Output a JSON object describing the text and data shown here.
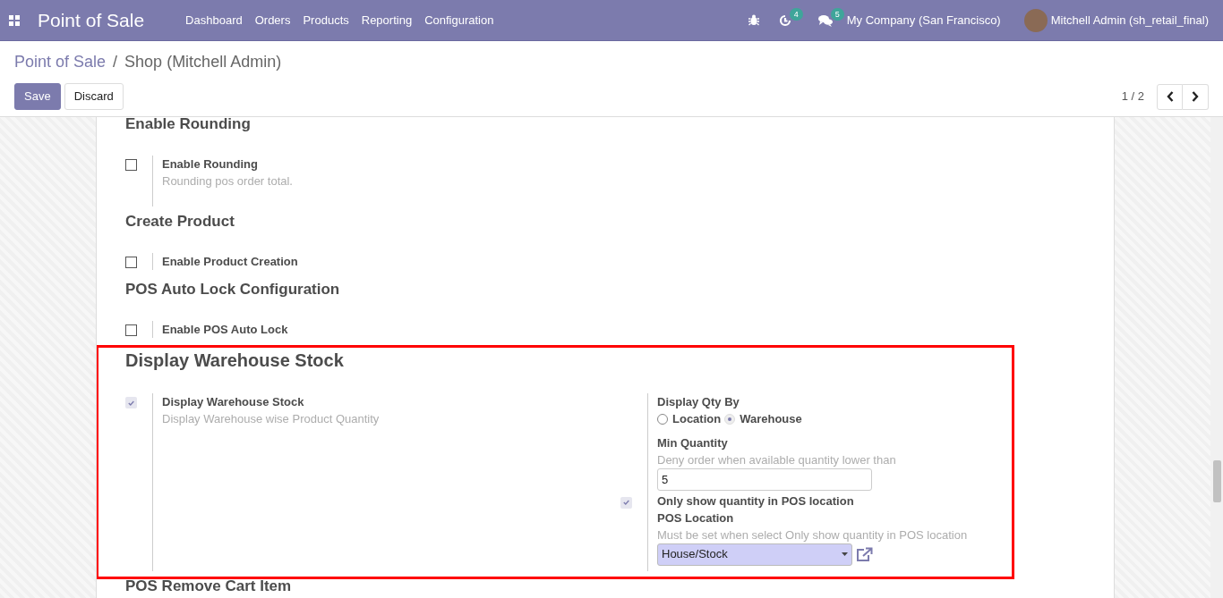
{
  "navbar": {
    "brand": "Point of Sale",
    "menu": [
      "Dashboard",
      "Orders",
      "Products",
      "Reporting",
      "Configuration"
    ],
    "activity_count": "4",
    "message_count": "5",
    "company": "My Company (San Francisco)",
    "user": "Mitchell Admin (sh_retail_final)"
  },
  "breadcrumb": [
    {
      "label": "Point of Sale",
      "link": true
    },
    {
      "label": "Shop (Mitchell Admin)",
      "link": false
    }
  ],
  "breadcrumb_separator": "/",
  "buttons": [
    {
      "label": "Save",
      "kind": "primary"
    },
    {
      "label": "Discard",
      "kind": "secondary"
    }
  ],
  "pager": "1 / 2",
  "sections": [
    {
      "title": "Enable Rounding",
      "highlighted": false,
      "settings": [
        {
          "label": "Enable Rounding",
          "description": "Rounding pos order total.",
          "checked": false
        }
      ]
    },
    {
      "title": "Create Product",
      "highlighted": false,
      "settings": [
        {
          "label": "Enable Product Creation",
          "checked": false
        }
      ]
    },
    {
      "title": "POS Auto Lock Configuration",
      "highlighted": false,
      "settings": [
        {
          "label": "Enable POS Auto Lock",
          "checked": false
        }
      ]
    },
    {
      "title": "Display Warehouse Stock",
      "highlighted": true,
      "settings": [
        {
          "label": "Display Warehouse Stock",
          "description": "Display Warehouse wise Product Quantity",
          "checked": true
        }
      ],
      "options": [
        {
          "kind": "radio",
          "label": "Display Qty By",
          "choices": [
            {
              "label": "Location",
              "selected": false
            },
            {
              "label": "Warehouse",
              "selected": true
            }
          ]
        },
        {
          "kind": "input",
          "label": "Min Quantity",
          "description": "Deny order when available quantity lower than",
          "value": "5"
        },
        {
          "kind": "checkbox",
          "label": "Only show quantity in POS location",
          "checked": true
        },
        {
          "kind": "select",
          "label": "POS Location",
          "description": "Must be set when select Only show quantity in POS location",
          "value": "House/Stock"
        }
      ]
    },
    {
      "title": "POS Remove Cart Item",
      "highlighted": false
    }
  ]
}
